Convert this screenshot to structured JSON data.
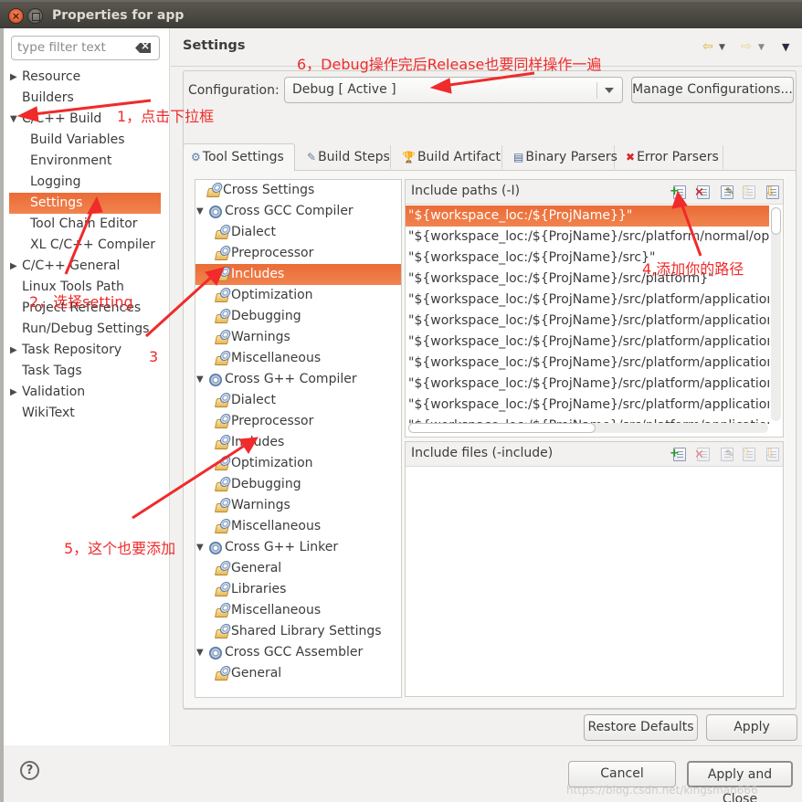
{
  "window": {
    "title": "Properties for app"
  },
  "sidebar": {
    "filter_placeholder": "type filter text",
    "items": [
      {
        "label": "Resource",
        "expandable": true,
        "expanded": false,
        "level": 0
      },
      {
        "label": "Builders",
        "expandable": false,
        "level": 0
      },
      {
        "label": "C/C++ Build",
        "expandable": true,
        "expanded": true,
        "level": 0
      },
      {
        "label": "Build Variables",
        "level": 1
      },
      {
        "label": "Environment",
        "level": 1
      },
      {
        "label": "Logging",
        "level": 1
      },
      {
        "label": "Settings",
        "level": 1,
        "selected": true
      },
      {
        "label": "Tool Chain Editor",
        "level": 1
      },
      {
        "label": "XL C/C++ Compiler",
        "level": 1
      },
      {
        "label": "C/C++ General",
        "expandable": true,
        "expanded": false,
        "level": 0
      },
      {
        "label": "Linux Tools Path",
        "level": 0
      },
      {
        "label": "Project References",
        "level": 0
      },
      {
        "label": "Run/Debug Settings",
        "level": 0
      },
      {
        "label": "Task Repository",
        "expandable": true,
        "expanded": false,
        "level": 0
      },
      {
        "label": "Task Tags",
        "level": 0
      },
      {
        "label": "Validation",
        "expandable": true,
        "expanded": false,
        "level": 0
      },
      {
        "label": "WikiText",
        "level": 0
      }
    ]
  },
  "header": {
    "title": "Settings",
    "back_icon": "back-arrow-icon",
    "forward_icon": "forward-arrow-icon",
    "menu_icon": "view-menu-icon"
  },
  "configuration": {
    "label": "Configuration:",
    "value": "Debug  [ Active ]",
    "manage_button": "Manage Configurations..."
  },
  "tabs": [
    {
      "label": "Tool Settings",
      "icon": "tool-settings-icon",
      "active": true
    },
    {
      "label": "Build Steps",
      "icon": "build-steps-icon"
    },
    {
      "label": "Build Artifact",
      "icon": "trophy-icon"
    },
    {
      "label": "Binary Parsers",
      "icon": "binary-file-icon"
    },
    {
      "label": "Error Parsers",
      "icon": "error-icon"
    }
  ],
  "tool_tree": [
    {
      "label": "Cross Settings",
      "level": 1,
      "icon": "folder"
    },
    {
      "label": "Cross GCC Compiler",
      "level": 0,
      "icon": "gear",
      "expanded": true
    },
    {
      "label": "Dialect",
      "level": 1,
      "icon": "folder"
    },
    {
      "label": "Preprocessor",
      "level": 1,
      "icon": "folder"
    },
    {
      "label": "Includes",
      "level": 1,
      "icon": "folder",
      "selected": true
    },
    {
      "label": "Optimization",
      "level": 1,
      "icon": "folder"
    },
    {
      "label": "Debugging",
      "level": 1,
      "icon": "folder"
    },
    {
      "label": "Warnings",
      "level": 1,
      "icon": "folder"
    },
    {
      "label": "Miscellaneous",
      "level": 1,
      "icon": "folder"
    },
    {
      "label": "Cross G++ Compiler",
      "level": 0,
      "icon": "gear",
      "expanded": true
    },
    {
      "label": "Dialect",
      "level": 1,
      "icon": "folder"
    },
    {
      "label": "Preprocessor",
      "level": 1,
      "icon": "folder"
    },
    {
      "label": "Includes",
      "level": 1,
      "icon": "folder"
    },
    {
      "label": "Optimization",
      "level": 1,
      "icon": "folder"
    },
    {
      "label": "Debugging",
      "level": 1,
      "icon": "folder"
    },
    {
      "label": "Warnings",
      "level": 1,
      "icon": "folder"
    },
    {
      "label": "Miscellaneous",
      "level": 1,
      "icon": "folder"
    },
    {
      "label": "Cross G++ Linker",
      "level": 0,
      "icon": "gear",
      "expanded": true
    },
    {
      "label": "General",
      "level": 1,
      "icon": "folder"
    },
    {
      "label": "Libraries",
      "level": 1,
      "icon": "folder"
    },
    {
      "label": "Miscellaneous",
      "level": 1,
      "icon": "folder"
    },
    {
      "label": "Shared Library Settings",
      "level": 1,
      "icon": "folder"
    },
    {
      "label": "Cross GCC Assembler",
      "level": 0,
      "icon": "gear",
      "expanded": true
    },
    {
      "label": "General",
      "level": 1,
      "icon": "folder"
    }
  ],
  "include_paths": {
    "label": "Include paths (-I)",
    "toolbar": [
      "add-icon",
      "delete-icon",
      "edit-icon",
      "move-up-icon",
      "move-down-icon"
    ],
    "rows": [
      "\"${workspace_loc:/${ProjName}}\"",
      "\"${workspace_loc:/${ProjName}/src/platform/normal/oper",
      "\"${workspace_loc:/${ProjName}/src}\"",
      "\"${workspace_loc:/${ProjName}/src/platform}\"",
      "\"${workspace_loc:/${ProjName}/src/platform/application}",
      "\"${workspace_loc:/${ProjName}/src/platform/application/",
      "\"${workspace_loc:/${ProjName}/src/platform/application/",
      "\"${workspace_loc:/${ProjName}/src/platform/application/",
      "\"${workspace_loc:/${ProjName}/src/platform/application/",
      "\"${workspace_loc:/${ProjName}/src/platform/application/",
      "\"${workspace_loc:/${ProjName}/src/platform/application/"
    ],
    "selected_index": 0
  },
  "include_files": {
    "label": "Include files (-include)",
    "toolbar": [
      "add-icon",
      "delete-icon",
      "edit-icon",
      "move-up-icon",
      "move-down-icon"
    ],
    "rows": []
  },
  "buttons": {
    "restore_defaults": "Restore Defaults",
    "apply": "Apply",
    "cancel": "Cancel",
    "apply_and_close": "Apply and Close"
  },
  "annotations": {
    "a1": "1，点击下拉框",
    "a2": "2，选择setting",
    "a3": "3",
    "a4": "4,添加你的路径",
    "a5": "5，这个也要添加",
    "a6": "6，Debug操作完后Release也要同样操作一遍"
  },
  "watermark": "https://blog.csdn.net/kingsman666",
  "colors": {
    "selection": "#ee7640",
    "annotation": "#ef2b2b"
  }
}
